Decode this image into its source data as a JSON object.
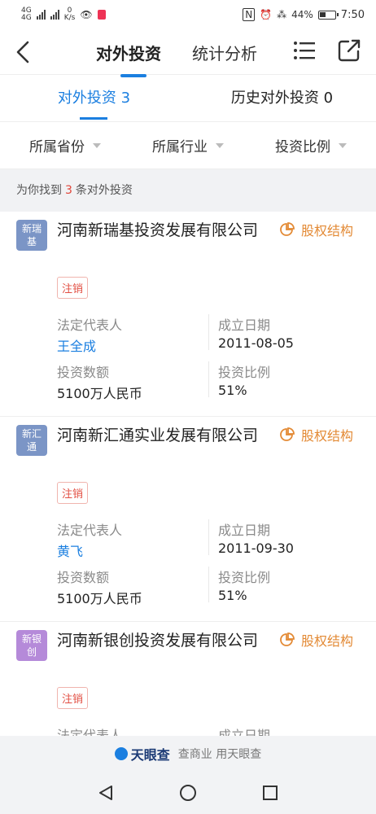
{
  "status_bar": {
    "left_labels": [
      "4G",
      "4G"
    ],
    "speed": "0",
    "speed_unit": "K/s",
    "battery": "44%",
    "time": "7:50"
  },
  "nav": {
    "tabs": [
      "对外投资",
      "统计分析"
    ],
    "active_tab": "对外投资"
  },
  "subtabs": [
    {
      "label": "对外投资 3"
    },
    {
      "label": "历史对外投资 0"
    }
  ],
  "filters": [
    "所属省份",
    "所属行业",
    "投资比例"
  ],
  "result": {
    "prefix": "为你找到",
    "count": "3",
    "suffix": "条对外投资"
  },
  "labels": {
    "legal_rep": "法定代表人",
    "found_date": "成立日期",
    "amount": "投资数额",
    "ratio": "投资比例",
    "equity": "股权结构"
  },
  "companies": [
    {
      "logo_text": "新瑞\n基",
      "logo_color": "#7b95c6",
      "name": "河南新瑞基投资发展有限公司",
      "status": "注销",
      "legal_rep": "王全成",
      "found_date": "2011-08-05",
      "amount": "5100万人民币",
      "ratio": "51%"
    },
    {
      "logo_text": "新汇\n通",
      "logo_color": "#7b95c6",
      "name": "河南新汇通实业发展有限公司",
      "status": "注销",
      "legal_rep": "黄飞",
      "found_date": "2011-09-30",
      "amount": "5100万人民币",
      "ratio": "51%"
    },
    {
      "logo_text": "新银\n创",
      "logo_color": "#b58ad9",
      "name": "河南新银创投资发展有限公司",
      "status": "注销",
      "legal_rep_label_only": true
    }
  ],
  "brand": {
    "name": "天眼查",
    "slogan": "查商业 用天眼查"
  }
}
